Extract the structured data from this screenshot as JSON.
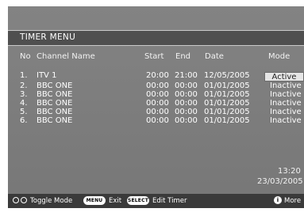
{
  "title": "TIMER MENU",
  "headers": {
    "no": "No",
    "channel": "Channel Name",
    "start": "Start",
    "end": "End",
    "date": "Date",
    "mode": "Mode"
  },
  "rows": [
    {
      "no": "1.",
      "channel": "ITV 1",
      "start": "20:00",
      "end": "21:00",
      "date": "12/05/2005",
      "mode": "Active"
    },
    {
      "no": "2.",
      "channel": "BBC ONE",
      "start": "00:00",
      "end": "00:00",
      "date": "01/01/2005",
      "mode": "Inactive"
    },
    {
      "no": "3.",
      "channel": "BBC ONE",
      "start": "00:00",
      "end": "00:00",
      "date": "01/01/2005",
      "mode": "Inactive"
    },
    {
      "no": "4.",
      "channel": "BBC ONE",
      "start": "00:00",
      "end": "00:00",
      "date": "01/01/2005",
      "mode": "Inactive"
    },
    {
      "no": "5.",
      "channel": "BBC ONE",
      "start": "00:00",
      "end": "00:00",
      "date": "01/01/2005",
      "mode": "Inactive"
    },
    {
      "no": "6.",
      "channel": "BBC ONE",
      "start": "00:00",
      "end": "00:00",
      "date": "01/01/2005",
      "mode": "Inactive"
    }
  ],
  "clock": {
    "time": "13:20",
    "date": "23/03/2005"
  },
  "footer": {
    "toggle": "Toggle Mode",
    "menu_key": "MENU",
    "exit": "Exit",
    "select_key": "SELECT",
    "edit": "Edit Timer",
    "info_key": "i",
    "more": "More"
  }
}
